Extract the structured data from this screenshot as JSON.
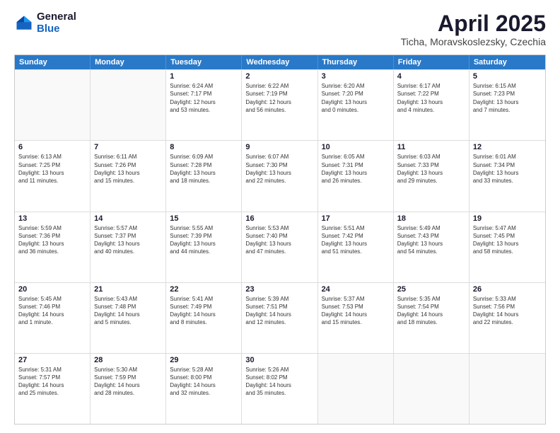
{
  "logo": {
    "general": "General",
    "blue": "Blue"
  },
  "title": {
    "month": "April 2025",
    "location": "Ticha, Moravskoslezsky, Czechia"
  },
  "header_days": [
    "Sunday",
    "Monday",
    "Tuesday",
    "Wednesday",
    "Thursday",
    "Friday",
    "Saturday"
  ],
  "weeks": [
    [
      {
        "day": "",
        "lines": []
      },
      {
        "day": "",
        "lines": []
      },
      {
        "day": "1",
        "lines": [
          "Sunrise: 6:24 AM",
          "Sunset: 7:17 PM",
          "Daylight: 12 hours",
          "and 53 minutes."
        ]
      },
      {
        "day": "2",
        "lines": [
          "Sunrise: 6:22 AM",
          "Sunset: 7:19 PM",
          "Daylight: 12 hours",
          "and 56 minutes."
        ]
      },
      {
        "day": "3",
        "lines": [
          "Sunrise: 6:20 AM",
          "Sunset: 7:20 PM",
          "Daylight: 13 hours",
          "and 0 minutes."
        ]
      },
      {
        "day": "4",
        "lines": [
          "Sunrise: 6:17 AM",
          "Sunset: 7:22 PM",
          "Daylight: 13 hours",
          "and 4 minutes."
        ]
      },
      {
        "day": "5",
        "lines": [
          "Sunrise: 6:15 AM",
          "Sunset: 7:23 PM",
          "Daylight: 13 hours",
          "and 7 minutes."
        ]
      }
    ],
    [
      {
        "day": "6",
        "lines": [
          "Sunrise: 6:13 AM",
          "Sunset: 7:25 PM",
          "Daylight: 13 hours",
          "and 11 minutes."
        ]
      },
      {
        "day": "7",
        "lines": [
          "Sunrise: 6:11 AM",
          "Sunset: 7:26 PM",
          "Daylight: 13 hours",
          "and 15 minutes."
        ]
      },
      {
        "day": "8",
        "lines": [
          "Sunrise: 6:09 AM",
          "Sunset: 7:28 PM",
          "Daylight: 13 hours",
          "and 18 minutes."
        ]
      },
      {
        "day": "9",
        "lines": [
          "Sunrise: 6:07 AM",
          "Sunset: 7:30 PM",
          "Daylight: 13 hours",
          "and 22 minutes."
        ]
      },
      {
        "day": "10",
        "lines": [
          "Sunrise: 6:05 AM",
          "Sunset: 7:31 PM",
          "Daylight: 13 hours",
          "and 26 minutes."
        ]
      },
      {
        "day": "11",
        "lines": [
          "Sunrise: 6:03 AM",
          "Sunset: 7:33 PM",
          "Daylight: 13 hours",
          "and 29 minutes."
        ]
      },
      {
        "day": "12",
        "lines": [
          "Sunrise: 6:01 AM",
          "Sunset: 7:34 PM",
          "Daylight: 13 hours",
          "and 33 minutes."
        ]
      }
    ],
    [
      {
        "day": "13",
        "lines": [
          "Sunrise: 5:59 AM",
          "Sunset: 7:36 PM",
          "Daylight: 13 hours",
          "and 36 minutes."
        ]
      },
      {
        "day": "14",
        "lines": [
          "Sunrise: 5:57 AM",
          "Sunset: 7:37 PM",
          "Daylight: 13 hours",
          "and 40 minutes."
        ]
      },
      {
        "day": "15",
        "lines": [
          "Sunrise: 5:55 AM",
          "Sunset: 7:39 PM",
          "Daylight: 13 hours",
          "and 44 minutes."
        ]
      },
      {
        "day": "16",
        "lines": [
          "Sunrise: 5:53 AM",
          "Sunset: 7:40 PM",
          "Daylight: 13 hours",
          "and 47 minutes."
        ]
      },
      {
        "day": "17",
        "lines": [
          "Sunrise: 5:51 AM",
          "Sunset: 7:42 PM",
          "Daylight: 13 hours",
          "and 51 minutes."
        ]
      },
      {
        "day": "18",
        "lines": [
          "Sunrise: 5:49 AM",
          "Sunset: 7:43 PM",
          "Daylight: 13 hours",
          "and 54 minutes."
        ]
      },
      {
        "day": "19",
        "lines": [
          "Sunrise: 5:47 AM",
          "Sunset: 7:45 PM",
          "Daylight: 13 hours",
          "and 58 minutes."
        ]
      }
    ],
    [
      {
        "day": "20",
        "lines": [
          "Sunrise: 5:45 AM",
          "Sunset: 7:46 PM",
          "Daylight: 14 hours",
          "and 1 minute."
        ]
      },
      {
        "day": "21",
        "lines": [
          "Sunrise: 5:43 AM",
          "Sunset: 7:48 PM",
          "Daylight: 14 hours",
          "and 5 minutes."
        ]
      },
      {
        "day": "22",
        "lines": [
          "Sunrise: 5:41 AM",
          "Sunset: 7:49 PM",
          "Daylight: 14 hours",
          "and 8 minutes."
        ]
      },
      {
        "day": "23",
        "lines": [
          "Sunrise: 5:39 AM",
          "Sunset: 7:51 PM",
          "Daylight: 14 hours",
          "and 12 minutes."
        ]
      },
      {
        "day": "24",
        "lines": [
          "Sunrise: 5:37 AM",
          "Sunset: 7:53 PM",
          "Daylight: 14 hours",
          "and 15 minutes."
        ]
      },
      {
        "day": "25",
        "lines": [
          "Sunrise: 5:35 AM",
          "Sunset: 7:54 PM",
          "Daylight: 14 hours",
          "and 18 minutes."
        ]
      },
      {
        "day": "26",
        "lines": [
          "Sunrise: 5:33 AM",
          "Sunset: 7:56 PM",
          "Daylight: 14 hours",
          "and 22 minutes."
        ]
      }
    ],
    [
      {
        "day": "27",
        "lines": [
          "Sunrise: 5:31 AM",
          "Sunset: 7:57 PM",
          "Daylight: 14 hours",
          "and 25 minutes."
        ]
      },
      {
        "day": "28",
        "lines": [
          "Sunrise: 5:30 AM",
          "Sunset: 7:59 PM",
          "Daylight: 14 hours",
          "and 28 minutes."
        ]
      },
      {
        "day": "29",
        "lines": [
          "Sunrise: 5:28 AM",
          "Sunset: 8:00 PM",
          "Daylight: 14 hours",
          "and 32 minutes."
        ]
      },
      {
        "day": "30",
        "lines": [
          "Sunrise: 5:26 AM",
          "Sunset: 8:02 PM",
          "Daylight: 14 hours",
          "and 35 minutes."
        ]
      },
      {
        "day": "",
        "lines": []
      },
      {
        "day": "",
        "lines": []
      },
      {
        "day": "",
        "lines": []
      }
    ]
  ]
}
